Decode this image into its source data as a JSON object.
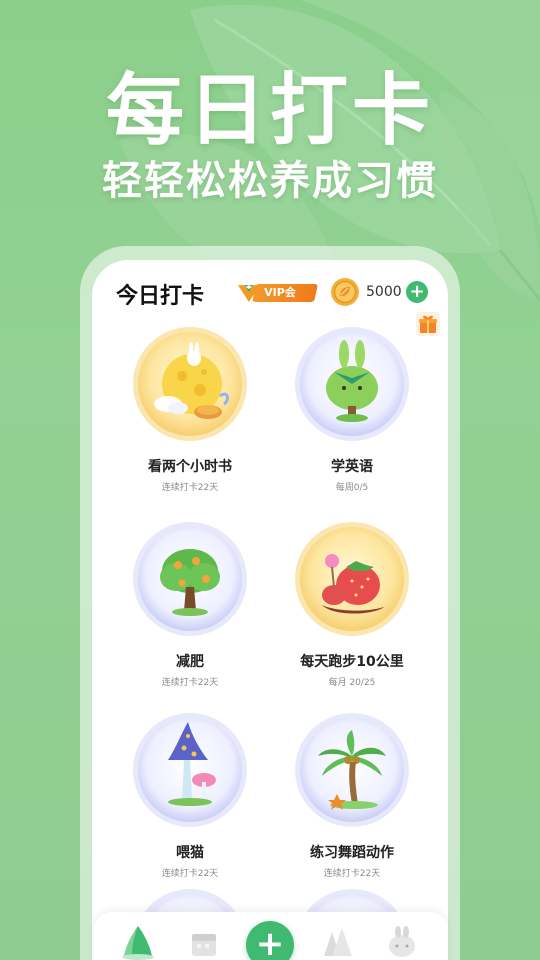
{
  "hero": {
    "title": "每日打卡",
    "subtitle": "轻轻松松养成习惯"
  },
  "header": {
    "title": "今日打卡",
    "vip_label": "VIP会员",
    "coins": "5000",
    "add_coin": "+"
  },
  "habits": [
    {
      "name": "看两个小时书",
      "sub": "连续打卡22天",
      "icon": "moon-rabbit-icon"
    },
    {
      "name": "学英语",
      "sub": "每周0/5",
      "icon": "bunny-bush-icon"
    },
    {
      "name": "减肥",
      "sub": "连续打卡22天",
      "icon": "fruit-tree-icon"
    },
    {
      "name": "每天跑步10公里",
      "sub": "每月 20/25",
      "icon": "strawberry-icon"
    },
    {
      "name": "喂猫",
      "sub": "连续打卡22天",
      "icon": "mushroom-icon"
    },
    {
      "name": "练习舞蹈动作",
      "sub": "连续打卡22天",
      "icon": "palm-tree-icon"
    }
  ],
  "nav": {
    "add": "+",
    "items": [
      "tree-tab-icon",
      "calendar-tab-icon",
      "add-tab-icon",
      "forest-tab-icon",
      "pet-tab-icon"
    ]
  },
  "colors": {
    "background": "#8fcd8f",
    "accent_green": "#3fba70",
    "vip_orange": "#f28a22"
  }
}
